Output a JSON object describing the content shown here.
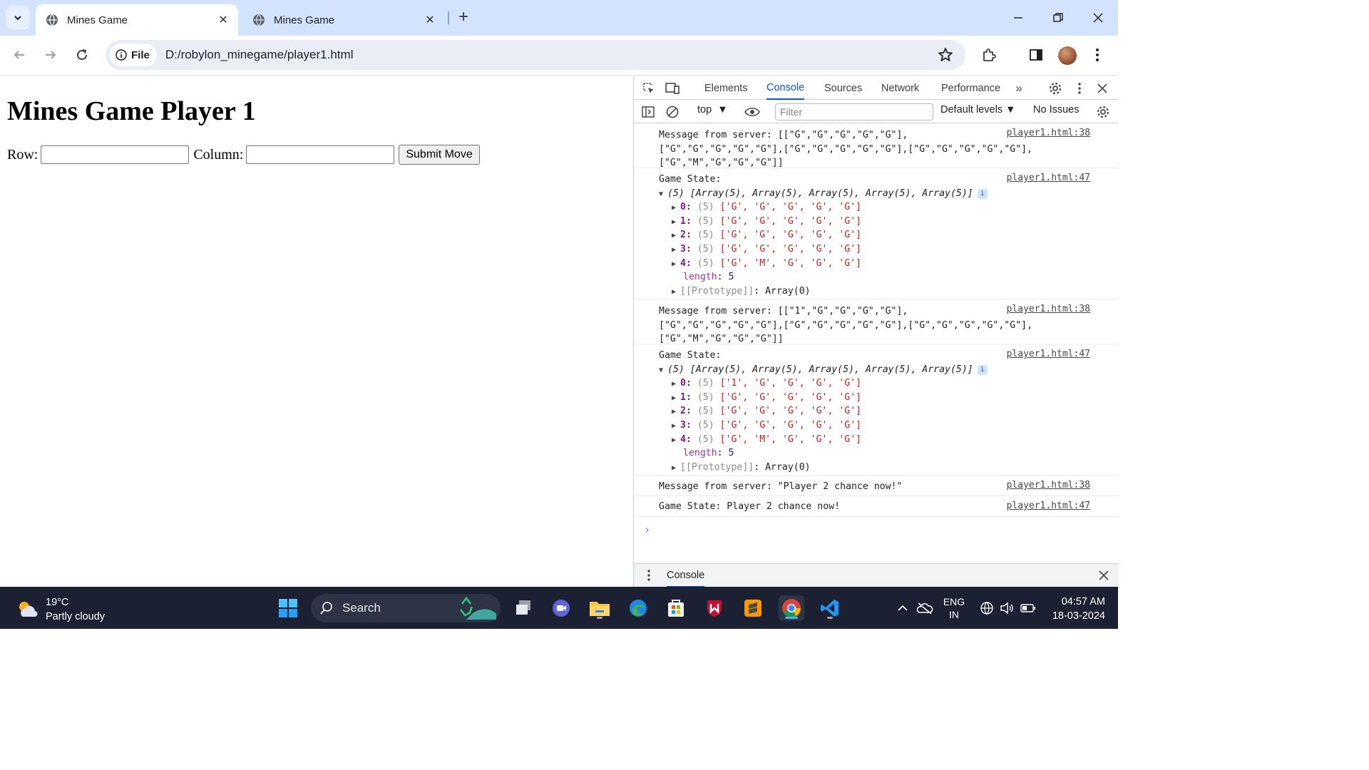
{
  "browser": {
    "tabs": [
      {
        "title": "Mines Game",
        "active": true
      },
      {
        "title": "Mines Game",
        "active": false
      }
    ],
    "address": {
      "chip": "File",
      "url": "D:/robylon_minegame/player1.html"
    }
  },
  "page": {
    "heading": "Mines Game Player 1",
    "row_label": "Row:",
    "column_label": "Column:",
    "row_value": "",
    "column_value": "",
    "submit_label": "Submit Move"
  },
  "devtools": {
    "tabs": [
      "Elements",
      "Console",
      "Sources",
      "Network",
      "Performance"
    ],
    "active_tab": "Console",
    "context": "top",
    "filter_placeholder": "Filter",
    "levels": "Default levels",
    "issues": "No Issues",
    "drawer_tab": "Console",
    "messages": [
      {
        "line1": "Message from server: [[\"G\",\"G\",\"G\",\"G\",\"G\"],",
        "line2": "[\"G\",\"G\",\"G\",\"G\",\"G\"],[\"G\",\"G\",\"G\",\"G\",\"G\"],[\"G\",\"G\",\"G\",\"G\",\"G\"],",
        "line3": "[\"G\",\"M\",\"G\",\"G\",\"G\"]]",
        "source": "player1.html:38"
      },
      {
        "label": "Game State:",
        "summary": "(5) [Array(5), Array(5), Array(5), Array(5), Array(5)]",
        "rows": [
          {
            "index": "0:",
            "len": "(5)",
            "values": "['G', 'G', 'G', 'G', 'G']"
          },
          {
            "index": "1:",
            "len": "(5)",
            "values": "['G', 'G', 'G', 'G', 'G']"
          },
          {
            "index": "2:",
            "len": "(5)",
            "values": "['G', 'G', 'G', 'G', 'G']"
          },
          {
            "index": "3:",
            "len": "(5)",
            "values": "['G', 'G', 'G', 'G', 'G']"
          },
          {
            "index": "4:",
            "len": "(5)",
            "values": "['G', 'M', 'G', 'G', 'G']"
          }
        ],
        "length_key": "length",
        "length_val": "5",
        "proto_key": "[[Prototype]]",
        "proto_val": "Array(0)",
        "source": "player1.html:47"
      },
      {
        "line1": "Message from server: [[\"1\",\"G\",\"G\",\"G\",\"G\"],",
        "line2": "[\"G\",\"G\",\"G\",\"G\",\"G\"],[\"G\",\"G\",\"G\",\"G\",\"G\"],[\"G\",\"G\",\"G\",\"G\",\"G\"],",
        "line3": "[\"G\",\"M\",\"G\",\"G\",\"G\"]]",
        "source": "player1.html:38"
      },
      {
        "label": "Game State:",
        "summary": "(5) [Array(5), Array(5), Array(5), Array(5), Array(5)]",
        "rows": [
          {
            "index": "0:",
            "len": "(5)",
            "values": "['1', 'G', 'G', 'G', 'G']"
          },
          {
            "index": "1:",
            "len": "(5)",
            "values": "['G', 'G', 'G', 'G', 'G']"
          },
          {
            "index": "2:",
            "len": "(5)",
            "values": "['G', 'G', 'G', 'G', 'G']"
          },
          {
            "index": "3:",
            "len": "(5)",
            "values": "['G', 'G', 'G', 'G', 'G']"
          },
          {
            "index": "4:",
            "len": "(5)",
            "values": "['G', 'M', 'G', 'G', 'G']"
          }
        ],
        "length_key": "length",
        "length_val": "5",
        "proto_key": "[[Prototype]]",
        "proto_val": "Array(0)",
        "source": "player1.html:47"
      },
      {
        "text": "Message from server: \"Player 2 chance now!\"",
        "source": "player1.html:38"
      },
      {
        "text": "Game State: Player 2 chance now!",
        "source": "player1.html:47"
      }
    ]
  },
  "taskbar": {
    "weather_temp": "19°C",
    "weather_desc": "Partly cloudy",
    "search_label": "Search",
    "lang1": "ENG",
    "lang2": "IN",
    "time": "04:57 AM",
    "date": "18-03-2024"
  },
  "colors": {
    "tabstrip": "#d3e3fd",
    "accent": "#0b57d0",
    "taskbar": "#1c2033"
  }
}
